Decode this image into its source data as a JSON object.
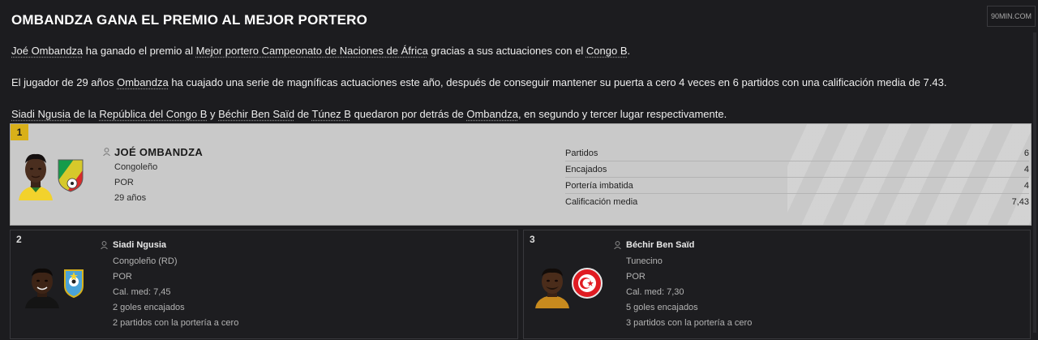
{
  "header": {
    "title": "OMBANDZA GANA EL PREMIO AL MEJOR PORTERO",
    "source": "90MIN.COM"
  },
  "article": {
    "p1": {
      "s1": "Joé Ombandza",
      "s2": " ha ganado el premio al ",
      "s3": "Mejor portero Campeonato de Naciones de África",
      "s4": " gracias a sus actuaciones con el ",
      "s5": "Congo B",
      "s6": "."
    },
    "p2": {
      "s1": "El jugador de 29 años ",
      "s2": "Ombandza",
      "s3": " ha cuajado una serie de magníficas actuaciones este año, después de conseguir mantener su puerta a cero 4 veces en 6 partidos con una calificación media de 7.43."
    },
    "p3": {
      "s1": "Siadi Ngusia",
      "s2": " de la ",
      "s3": "República del Congo B",
      "s4": " y ",
      "s5": "Béchir Ben Saïd",
      "s6": " de ",
      "s7": "Túnez B",
      "s8": " quedaron por detrás de ",
      "s9": "Ombandza",
      "s10": ", en segundo y tercer lugar respectivamente."
    }
  },
  "winner": {
    "rank": "1",
    "name": "JOÉ OMBANDZA",
    "nationality": "Congoleño",
    "position": "POR",
    "age": "29 años",
    "stats": [
      {
        "label": "Partidos",
        "value": "6"
      },
      {
        "label": "Encajados",
        "value": "4"
      },
      {
        "label": "Portería imbatida",
        "value": "4"
      },
      {
        "label": "Calificación media",
        "value": "7,43"
      }
    ]
  },
  "runners": [
    {
      "rank": "2",
      "name": "Siadi Ngusia",
      "nationality": "Congoleño (RD)",
      "position": "POR",
      "rating": "Cal. med: 7,45",
      "conceded": "2 goles encajados",
      "clean_sheets": "2 partidos con la portería a cero"
    },
    {
      "rank": "3",
      "name": "Béchir Ben Saïd",
      "nationality": "Tunecino",
      "position": "POR",
      "rating": "Cal. med: 7,30",
      "conceded": "5 goles encajados",
      "clean_sheets": "3 partidos con la portería a cero"
    }
  ],
  "icons": {
    "person": "person-icon",
    "congo_flag": "congo-flag-icon",
    "drc_crest": "drc-federation-crest-icon",
    "tunisia_crest": "tunisia-federation-crest-icon"
  },
  "colors": {
    "background": "#1c1c1f",
    "winner_card": "#c9c9c9",
    "rank_gold": "#d9b019",
    "text": "#ededed"
  }
}
